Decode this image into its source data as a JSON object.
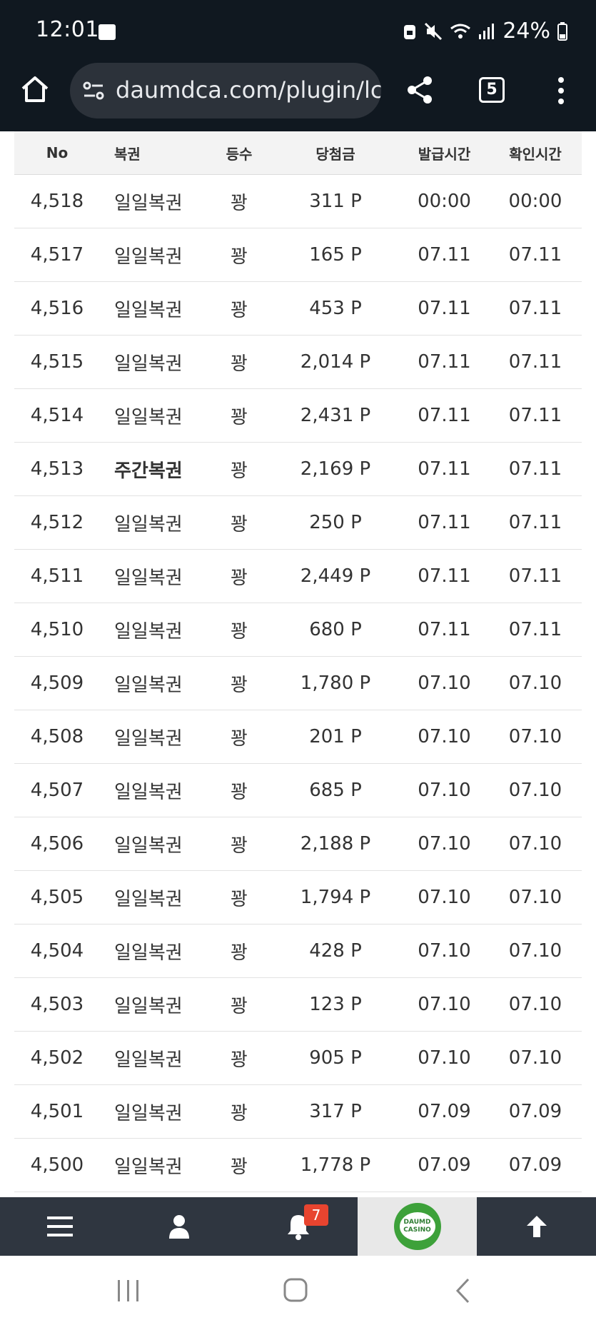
{
  "status_bar": {
    "time": "12:01",
    "battery": "24%",
    "icons": [
      "photo-icon",
      "alarm-lock-icon",
      "mute-icon",
      "wifi-icon",
      "signal-icon",
      "battery-icon"
    ]
  },
  "browser": {
    "url": "daumdca.com/plugin/lc",
    "tab_count": "5"
  },
  "table": {
    "headers": {
      "no": "No",
      "name": "복권",
      "rank": "등수",
      "prize": "당첨금",
      "issue_time": "발급시간",
      "check_time": "확인시간"
    },
    "rows": [
      {
        "no": "4,518",
        "name": "일일복권",
        "rank": "꽝",
        "prize": "311 P",
        "issue": "00:00",
        "check": "00:00"
      },
      {
        "no": "4,517",
        "name": "일일복권",
        "rank": "꽝",
        "prize": "165 P",
        "issue": "07.11",
        "check": "07.11"
      },
      {
        "no": "4,516",
        "name": "일일복권",
        "rank": "꽝",
        "prize": "453 P",
        "issue": "07.11",
        "check": "07.11"
      },
      {
        "no": "4,515",
        "name": "일일복권",
        "rank": "꽝",
        "prize": "2,014 P",
        "issue": "07.11",
        "check": "07.11"
      },
      {
        "no": "4,514",
        "name": "일일복권",
        "rank": "꽝",
        "prize": "2,431 P",
        "issue": "07.11",
        "check": "07.11"
      },
      {
        "no": "4,513",
        "name": "주간복권",
        "rank": "꽝",
        "prize": "2,169 P",
        "issue": "07.11",
        "check": "07.11"
      },
      {
        "no": "4,512",
        "name": "일일복권",
        "rank": "꽝",
        "prize": "250 P",
        "issue": "07.11",
        "check": "07.11"
      },
      {
        "no": "4,511",
        "name": "일일복권",
        "rank": "꽝",
        "prize": "2,449 P",
        "issue": "07.11",
        "check": "07.11"
      },
      {
        "no": "4,510",
        "name": "일일복권",
        "rank": "꽝",
        "prize": "680 P",
        "issue": "07.11",
        "check": "07.11"
      },
      {
        "no": "4,509",
        "name": "일일복권",
        "rank": "꽝",
        "prize": "1,780 P",
        "issue": "07.10",
        "check": "07.10"
      },
      {
        "no": "4,508",
        "name": "일일복권",
        "rank": "꽝",
        "prize": "201 P",
        "issue": "07.10",
        "check": "07.10"
      },
      {
        "no": "4,507",
        "name": "일일복권",
        "rank": "꽝",
        "prize": "685 P",
        "issue": "07.10",
        "check": "07.10"
      },
      {
        "no": "4,506",
        "name": "일일복권",
        "rank": "꽝",
        "prize": "2,188 P",
        "issue": "07.10",
        "check": "07.10"
      },
      {
        "no": "4,505",
        "name": "일일복권",
        "rank": "꽝",
        "prize": "1,794 P",
        "issue": "07.10",
        "check": "07.10"
      },
      {
        "no": "4,504",
        "name": "일일복권",
        "rank": "꽝",
        "prize": "428 P",
        "issue": "07.10",
        "check": "07.10"
      },
      {
        "no": "4,503",
        "name": "일일복권",
        "rank": "꽝",
        "prize": "123 P",
        "issue": "07.10",
        "check": "07.10"
      },
      {
        "no": "4,502",
        "name": "일일복권",
        "rank": "꽝",
        "prize": "905 P",
        "issue": "07.10",
        "check": "07.10"
      },
      {
        "no": "4,501",
        "name": "일일복권",
        "rank": "꽝",
        "prize": "317 P",
        "issue": "07.09",
        "check": "07.09"
      },
      {
        "no": "4,500",
        "name": "일일복권",
        "rank": "꽝",
        "prize": "1,778 P",
        "issue": "07.09",
        "check": "07.09"
      }
    ]
  },
  "bottom_nav": {
    "notification_count": "7",
    "logo_line1": "DAUMD",
    "logo_line2": "CASINO",
    "icons": [
      "menu-icon",
      "user-icon",
      "bell-icon",
      "logo",
      "arrow-up-icon"
    ]
  },
  "colors": {
    "status_bg": "#101820",
    "url_pill_bg": "#2c323a",
    "nav_bg": "#2f3640",
    "badge": "#e8442f",
    "logo_green": "#3da13a"
  }
}
